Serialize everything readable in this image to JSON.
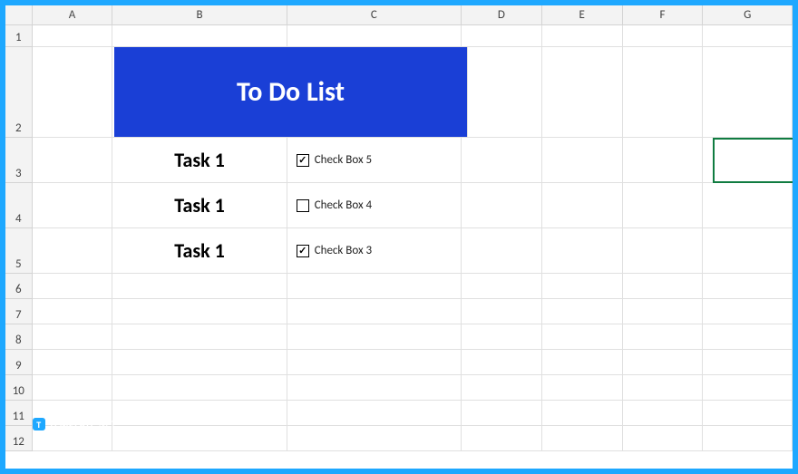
{
  "columns": [
    "A",
    "B",
    "C",
    "D",
    "E",
    "F",
    "G"
  ],
  "rows": [
    "1",
    "2",
    "3",
    "4",
    "5",
    "6",
    "7",
    "8",
    "9",
    "10",
    "11",
    "12"
  ],
  "title": "To Do List",
  "tasks": [
    {
      "label": "Task 1",
      "checkbox_label": "Check Box 5",
      "checked": true
    },
    {
      "label": "Task 1",
      "checkbox_label": "Check Box 4",
      "checked": false
    },
    {
      "label": "Task 1",
      "checkbox_label": "Check Box 3",
      "checked": true
    }
  ],
  "active_cell": "G3",
  "watermark": {
    "badge": "T",
    "text1": "TEMPLATE",
    "text2": ".NET"
  },
  "colors": {
    "frame": "#1ea8ff",
    "title_bg": "#1a3fd6",
    "selection": "#107c41"
  }
}
